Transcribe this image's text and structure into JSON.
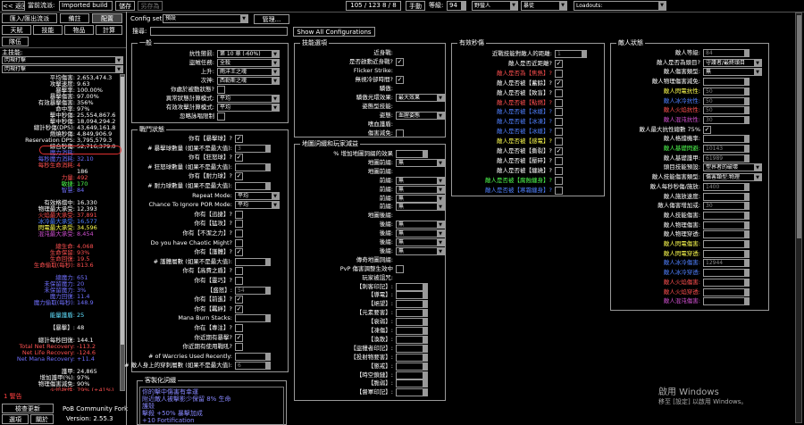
{
  "top": {
    "back": "<< 返回",
    "build_label": "當前流派:",
    "build_name": "Imported build",
    "save": "儲存",
    "save_as": "另存為",
    "points": "105 / 123   8 / 8",
    "manual": "手動",
    "level_label": "等級:",
    "level": "94",
    "class": "野蠻人",
    "ascendancy": "暴徒",
    "loadouts": "Loadouts:"
  },
  "left_tabs": {
    "import": "匯入/匯出流派",
    "notes": "備註",
    "config": "配置",
    "tree": "天賦",
    "skills": "技能",
    "items": "物品",
    "calcs": "計算",
    "party": "隊伍"
  },
  "main_skill": {
    "label": "主技能:",
    "skill": "閃現打擊",
    "part": "閃現打擊"
  },
  "stats": [
    {
      "label": "平均傷害:",
      "value": "2,653,474.3",
      "color": "#ffffff"
    },
    {
      "label": "攻擊速度:",
      "value": "9.63",
      "color": "#ffffff"
    },
    {
      "label": "暴擊率:",
      "value": "100.00%",
      "color": "#ffffff"
    },
    {
      "label": "暴擊傷害:",
      "value": "97.00%",
      "color": "#ffffff"
    },
    {
      "label": "有效暴擊傷害:",
      "value": "356%",
      "color": "#ffffff"
    },
    {
      "label": "命中率:",
      "value": "97%",
      "color": "#ffffff"
    },
    {
      "label": "擊中秒傷:",
      "value": "25,554,867.6",
      "color": "#ffffff"
    },
    {
      "label": "擊中秒傷:",
      "value": "18,094,294.2",
      "color": "#ffffff"
    },
    {
      "label": "總計秒傷(DPS):",
      "value": "43,649,161.8",
      "color": "#ffffff"
    },
    {
      "label": "燃燒秒傷:",
      "value": "4,849,906.9",
      "color": "#ffffff"
    },
    {
      "label": "Reservation DPS:",
      "value": "3,795,579.3",
      "color": "#ffffff"
    },
    {
      "label": "綜合秒傷:",
      "value": "52,716,379.0",
      "color": "#ffffff"
    },
    {
      "label": "魔力消耗:",
      "value": "",
      "color": "#7070ff"
    },
    {
      "label": "每秒魔力消耗:",
      "value": "32.10",
      "color": "#7070ff"
    },
    {
      "label": "每秒生命消耗:",
      "value": "4",
      "color": "#ff5050"
    },
    {
      "label": "",
      "value": "186",
      "color": "#ffffff"
    },
    {
      "label": "力量:",
      "value": "492",
      "color": "#ff5050"
    },
    {
      "label": "敏捷:",
      "value": "170",
      "color": "#50ff50"
    },
    {
      "label": "智慧:",
      "value": "84",
      "color": "#7070ff"
    },
    {
      "label": "",
      "value": "",
      "color": "#ffffff"
    },
    {
      "label": "有效格擋中:",
      "value": "16,330",
      "color": "#ffffff"
    },
    {
      "label": "物理最大承受:",
      "value": "12,393",
      "color": "#ffffff"
    },
    {
      "label": "火焰最大承受:",
      "value": "37,891",
      "color": "#ff5050"
    },
    {
      "label": "冰冷最大承受:",
      "value": "16,577",
      "color": "#5080ff"
    },
    {
      "label": "閃電最大承受:",
      "value": "34,596",
      "color": "#ffff50"
    },
    {
      "label": "混沌最大承受:",
      "value": "8,454",
      "color": "#d050d0"
    },
    {
      "label": "",
      "value": "",
      "color": "#ffffff"
    },
    {
      "label": "總生命:",
      "value": "4,068",
      "color": "#ff5050"
    },
    {
      "label": "生命保留:",
      "value": "93%",
      "color": "#ff5050"
    },
    {
      "label": "生命回復:",
      "value": "19.5",
      "color": "#ff5050"
    },
    {
      "label": "生命偷取(每秒):",
      "value": "813.6",
      "color": "#ff5050"
    },
    {
      "label": "",
      "value": "",
      "color": "#ffffff"
    },
    {
      "label": "總魔力:",
      "value": "651",
      "color": "#7070ff"
    },
    {
      "label": "未保留魔力:",
      "value": "20",
      "color": "#7070ff"
    },
    {
      "label": "未保留魔力:",
      "value": "3%",
      "color": "#7070ff"
    },
    {
      "label": "魔力回復:",
      "value": "11.4",
      "color": "#7070ff"
    },
    {
      "label": "魔力偷取(每秒):",
      "value": "148.9",
      "color": "#7070ff"
    },
    {
      "label": "",
      "value": "",
      "color": "#ffffff"
    },
    {
      "label": "能量護盾:",
      "value": "25",
      "color": "#60e0ff"
    },
    {
      "label": "",
      "value": "",
      "color": "#ffffff"
    },
    {
      "label": "【暴擊】:",
      "value": "48",
      "color": "#ffffff"
    },
    {
      "label": "",
      "value": "",
      "color": "#ffffff"
    },
    {
      "label": "總計每秒回復:",
      "value": "144.1",
      "color": "#ffffff"
    },
    {
      "label": "Total Net Recovery:",
      "value": "-113.2",
      "color": "#ff5050"
    },
    {
      "label": "Net Life Recovery:",
      "value": "-124.6",
      "color": "#ff5050"
    },
    {
      "label": "Net Mana Recovery:",
      "value": "+11.4",
      "color": "#7070ff"
    },
    {
      "label": "",
      "value": "",
      "color": "#ffffff"
    },
    {
      "label": "護甲:",
      "value": "24,865",
      "color": "#ffffff"
    },
    {
      "label": "增加護甲(%):",
      "value": "97%",
      "color": "#ffffff"
    },
    {
      "label": "物理傷害減免:",
      "value": "90%",
      "color": "#ffffff"
    },
    {
      "label": "火焰抗性:",
      "value": "79% (+41%)",
      "color": "#ff5050"
    }
  ],
  "warning": "1 警告",
  "bottom": {
    "check_update": "檢查更新",
    "options": "選項",
    "about": "關於",
    "app_name": "PoB Community Fork",
    "version": "Version: 2.55.3"
  },
  "config": {
    "set_label": "Config set:",
    "set_value": "預設",
    "manage": "管理...",
    "search_label": "搜尋:",
    "show_all": "Show All Configurations"
  },
  "general": {
    "title": "一般",
    "rows": [
      {
        "label": "抗性懲罰:",
        "type": "dd",
        "value": "第 10 章 (-60%)"
      },
      {
        "label": "盜賊任務:",
        "type": "dd",
        "value": "全殺"
      },
      {
        "label": "上升:",
        "type": "dd",
        "value": "雨洋王之魂"
      },
      {
        "label": "次神:",
        "type": "dd",
        "value": "西勒斯之魂"
      },
      {
        "label": "你處於被動狀態?",
        "type": "cb",
        "checked": false
      },
      {
        "label": "異常狀態計算模式:",
        "type": "dd",
        "value": "平均"
      },
      {
        "label": "有效攻擊計算模式:",
        "type": "dd",
        "value": "平均"
      },
      {
        "label": "忽略詠唱限制",
        "type": "cb",
        "checked": false
      }
    ]
  },
  "combat": {
    "title": "戰鬥狀態",
    "rows": [
      {
        "label": "你有【暴擊球】?",
        "type": "cb",
        "checked": true
      },
      {
        "label": "# 暴擊球數量 (如果不是最大值):",
        "type": "num",
        "value": "3"
      },
      {
        "label": "你有【狂怒球】?",
        "type": "cb",
        "checked": true
      },
      {
        "label": "# 狂怒球數量 (如果不是最大值):",
        "type": "num",
        "value": ""
      },
      {
        "label": "你有【耐力球】?",
        "type": "cb",
        "checked": true
      },
      {
        "label": "# 耐力球數量 (如果不是最大值):",
        "type": "num",
        "value": ""
      },
      {
        "label": "Repeat Mode:",
        "type": "dd",
        "value": "平均"
      },
      {
        "label": "Chance To Ignore POR Mode:",
        "type": "dd",
        "value": "平均"
      },
      {
        "label": "你有【迅捷】?",
        "type": "cb",
        "checked": false
      },
      {
        "label": "你有【猛攻】?",
        "type": "cb",
        "checked": false
      },
      {
        "label": "你有【不潔之力】?",
        "type": "cb",
        "checked": false
      },
      {
        "label": "Do you have Chaotic Might?",
        "type": "cb",
        "checked": false
      },
      {
        "label": "你有【護體】?",
        "type": "cb",
        "checked": true
      },
      {
        "label": "# 護體層數 (如果不是最大值):",
        "type": "num",
        "value": ""
      },
      {
        "label": "你有【高費之盾】?",
        "type": "cb",
        "checked": false
      },
      {
        "label": "你有【靈巧】?",
        "type": "cb",
        "checked": false
      },
      {
        "label": "【盛怒】:",
        "type": "num",
        "value": "54"
      },
      {
        "label": "你有【前進】?",
        "type": "cb",
        "checked": true
      },
      {
        "label": "你有【羈絆】?",
        "type": "cb",
        "checked": true
      },
      {
        "label": "Mana Burn Stacks:",
        "type": "num",
        "value": ""
      },
      {
        "label": "你在【專注】?",
        "type": "cb",
        "checked": false
      },
      {
        "label": "你近期有暴擊?",
        "type": "cb",
        "checked": true
      },
      {
        "label": "你近期有使用戰吼?",
        "type": "cb",
        "checked": false
      },
      {
        "label": "# of Warcries Used Recently:",
        "type": "num",
        "value": ""
      },
      {
        "label": "# 敵人身上的穿刺層數 (如果不是最大值):",
        "type": "num",
        "value": "6"
      }
    ]
  },
  "skill_opts": {
    "title": "技能選項",
    "rows": [
      {
        "label": "近身戰:",
        "type": "none"
      },
      {
        "label": "是否啟動近身戰?",
        "type": "cb",
        "checked": true
      },
      {
        "label": "Flicker Strike:",
        "type": "none"
      },
      {
        "label": "無視冷卻時間?",
        "type": "cb",
        "checked": true
      },
      {
        "label": "驕傲:",
        "type": "none"
      },
      {
        "label": "驕傲光環效果:",
        "type": "dd",
        "value": "最大效果"
      },
      {
        "label": "姿態型技能:",
        "type": "none"
      },
      {
        "label": "姿態:",
        "type": "dd",
        "value": "血腥姿態"
      },
      {
        "label": "嗜血護盾:",
        "type": "none"
      },
      {
        "label": "傷害減免:",
        "type": "cb",
        "checked": false
      }
    ]
  },
  "map_mods": {
    "title": "地圖詞綴和玩家減益",
    "rows": [
      {
        "label": "% 增加地圖詞綴的效果",
        "type": "num",
        "value": ""
      },
      {
        "label": "地圖前綴:",
        "type": "dd",
        "value": "無"
      },
      {
        "label": "地圖前綴:",
        "type": "none"
      },
      {
        "label": "前綴:",
        "type": "dd",
        "value": "無"
      },
      {
        "label": "前綴:",
        "type": "dd",
        "value": "無"
      },
      {
        "label": "前綴:",
        "type": "dd",
        "value": "無"
      },
      {
        "label": "前綴:",
        "type": "dd",
        "value": "無"
      },
      {
        "label": "地圖後綴:",
        "type": "none"
      },
      {
        "label": "後綴:",
        "type": "dd",
        "value": "無"
      },
      {
        "label": "後綴:",
        "type": "dd",
        "value": "無"
      },
      {
        "label": "後綴:",
        "type": "dd",
        "value": "無"
      },
      {
        "label": "後綴:",
        "type": "dd",
        "value": "無"
      },
      {
        "label": "傳奇地圖詞綴:",
        "type": "none"
      },
      {
        "label": "PvP 傷害調整生效中",
        "type": "cb",
        "checked": false
      },
      {
        "label": "玩家被詛咒:",
        "type": "none"
      },
      {
        "label": "【刺客印記】:",
        "type": "num",
        "value": ""
      },
      {
        "label": "【導電】:",
        "type": "num",
        "value": ""
      },
      {
        "label": "【絕望】:",
        "type": "num",
        "value": ""
      },
      {
        "label": "【元素要害】:",
        "type": "num",
        "value": ""
      },
      {
        "label": "【衰弱】:",
        "type": "num",
        "value": ""
      },
      {
        "label": "【凍傷】:",
        "type": "num",
        "value": ""
      },
      {
        "label": "【渙散】:",
        "type": "num",
        "value": ""
      },
      {
        "label": "【盜獵者印記】:",
        "type": "num",
        "value": ""
      },
      {
        "label": "【投射物要害】:",
        "type": "num",
        "value": ""
      },
      {
        "label": "【懲戒】:",
        "type": "num",
        "value": ""
      },
      {
        "label": "【時空鎖鏈】:",
        "type": "num",
        "value": ""
      },
      {
        "label": "【脆弱】:",
        "type": "num",
        "value": ""
      },
      {
        "label": "【督軍印記】:",
        "type": "num",
        "value": ""
      }
    ]
  },
  "effective_dps": {
    "title": "有效秒傷",
    "rows": [
      {
        "label": "近戰技能對敵人的距離:",
        "type": "num",
        "value": "1"
      },
      {
        "label": "敵人是否近距離?",
        "type": "cb",
        "checked": true,
        "color": "#ffffff"
      },
      {
        "label": "敵人是否為【焦熱】?",
        "type": "cb",
        "checked": false,
        "color": "#ff5050"
      },
      {
        "label": "敵人是否被【蓄餘】?",
        "type": "cb",
        "checked": true,
        "color": "#ffffff"
      },
      {
        "label": "敵人是否被【致盲】?",
        "type": "cb",
        "checked": false,
        "color": "#ffffff"
      },
      {
        "label": "敵人是否被【點燃】?",
        "type": "cb",
        "checked": false,
        "color": "#ff5050"
      },
      {
        "label": "敵人是否被【冰緩】?",
        "type": "cb",
        "checked": false,
        "color": "#5080ff"
      },
      {
        "label": "敵人是否被【冰凍】?",
        "type": "cb",
        "checked": false,
        "color": "#5080ff"
      },
      {
        "label": "敵人是否被【冰緩】?",
        "type": "cb",
        "checked": false,
        "color": "#5080ff"
      },
      {
        "label": "敵人是否被【感電】?",
        "type": "cb",
        "checked": false,
        "color": "#ffff50"
      },
      {
        "label": "敵人是否被【撕裂】?",
        "type": "cb",
        "checked": true,
        "color": "#ffffff"
      },
      {
        "label": "敵人是否被【壓碎】?",
        "type": "cb",
        "checked": false,
        "color": "#ffffff"
      },
      {
        "label": "敵人是否被【纏繞】?",
        "type": "cb",
        "checked": false,
        "color": "#ffffff"
      },
      {
        "label": "敵人是否被【腐蝕纏身】?",
        "type": "cb",
        "checked": false,
        "color": "#50ff50"
      },
      {
        "label": "敵人是否被【寒霜纏身】?",
        "type": "cb",
        "checked": false,
        "color": "#5080ff"
      }
    ]
  },
  "enemy_stats": {
    "title": "敵人狀態",
    "rows": [
      {
        "label": "敵人等級:",
        "type": "num",
        "value": "84",
        "color": "#ffffff"
      },
      {
        "label": "敵人是否為頭目?",
        "type": "dd",
        "value": "守護者/最終頭目",
        "color": "#ffffff"
      },
      {
        "label": "敵人傷害類型:",
        "type": "dd",
        "value": "無",
        "color": "#ffffff"
      },
      {
        "label": "敵人物理傷害減免:",
        "type": "num",
        "value": "",
        "color": "#ffffff"
      },
      {
        "label": "敵人閃電抗性:",
        "type": "num",
        "value": "50",
        "color": "#ffff50"
      },
      {
        "label": "敵人冰冷抗性:",
        "type": "num",
        "value": "50",
        "color": "#5080ff"
      },
      {
        "label": "敵人火焰抗性:",
        "type": "num",
        "value": "50",
        "color": "#ff5050"
      },
      {
        "label": "敵人混沌抗性:",
        "type": "num",
        "value": "30",
        "color": "#d050d0"
      },
      {
        "label": "敵人最大抗性總數 75%",
        "type": "cb",
        "checked": true,
        "color": "#ffffff"
      },
      {
        "label": "敵人格擋機率:",
        "type": "num",
        "value": "",
        "color": "#ffffff"
      },
      {
        "label": "敵人基礎閃避:",
        "type": "num",
        "value": "10143",
        "color": "#50ff50"
      },
      {
        "label": "敵人基礎護甲:",
        "type": "num",
        "value": "61989",
        "color": "#ffffff"
      },
      {
        "label": "頭目技能預設:",
        "type": "dd",
        "value": "塑界者的破壞",
        "color": "#ffffff"
      },
      {
        "label": "敵人技能傷害類型:",
        "type": "dd",
        "value": "傷害類型:物理",
        "color": "#ffffff"
      },
      {
        "label": "敵人每秒秒傷/施放:",
        "type": "num",
        "value": "1400",
        "color": "#ffffff"
      },
      {
        "label": "敵人施放速度:",
        "type": "num",
        "value": "",
        "color": "#ffffff"
      },
      {
        "label": "敵人傷害增加或:",
        "type": "num",
        "value": "30",
        "color": "#ffffff"
      },
      {
        "label": "敵人技能傷害:",
        "type": "num",
        "value": "",
        "color": "#ffffff"
      },
      {
        "label": "敵人物理傷害:",
        "type": "num",
        "value": "",
        "color": "#ffffff"
      },
      {
        "label": "敵人物理穿透:",
        "type": "num",
        "value": "",
        "color": "#ffffff"
      },
      {
        "label": "敵人閃電傷害:",
        "type": "num",
        "value": "",
        "color": "#ffff50"
      },
      {
        "label": "敵人閃電穿透:",
        "type": "num",
        "value": "",
        "color": "#ffff50"
      },
      {
        "label": "敵人冰冷傷害:",
        "type": "num",
        "value": "12944",
        "color": "#5080ff"
      },
      {
        "label": "敵人冰冷穿透:",
        "type": "num",
        "value": "",
        "color": "#5080ff"
      },
      {
        "label": "敵人火焰傷害:",
        "type": "num",
        "value": "",
        "color": "#ff5050"
      },
      {
        "label": "敵人火焰穿透:",
        "type": "num",
        "value": "",
        "color": "#ff5050"
      },
      {
        "label": "敵人混沌傷害:",
        "type": "num",
        "value": "",
        "color": "#d050d0"
      }
    ]
  },
  "custom_mods": {
    "title": "客製化詞綴",
    "lines": [
      "你的擊中傷害有幸運",
      "附近敵人被擊影少保留 8% 生命",
      "護殼",
      "擊殺 +50% 暴擊加成",
      "+10 Fortification"
    ]
  },
  "windows": {
    "line1": "啟用 Windows",
    "line2": "移至 [設定] 以啟用 Windows。"
  }
}
